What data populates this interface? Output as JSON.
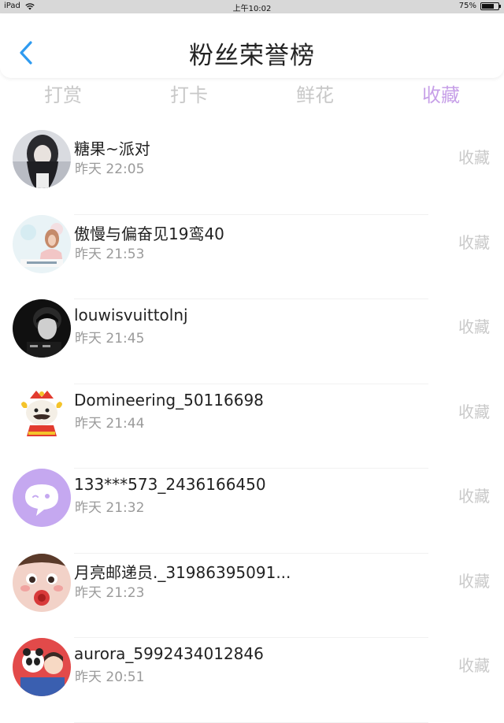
{
  "status_bar": {
    "device": "iPad",
    "time": "上午10:02",
    "battery": "75%",
    "battery_level": 0.75
  },
  "header": {
    "title": "粉丝荣誉榜",
    "back_icon": "chevron-left-icon",
    "accent_color": "#2f9bf0"
  },
  "tabs": [
    {
      "label": "打赏",
      "active": false
    },
    {
      "label": "打卡",
      "active": false
    },
    {
      "label": "鲜花",
      "active": false
    },
    {
      "label": "收藏",
      "active": true
    }
  ],
  "colors": {
    "active_tab": "#c7a0e8",
    "inactive_tab": "#c8c8c8",
    "muted_text": "#9a9a9a"
  },
  "fans": [
    {
      "name": "糖果~派对",
      "time": "昨天 22:05",
      "action": "收藏",
      "avatar": "avatar-girl-dark-hair"
    },
    {
      "name": "傲慢与偏奋见19鸾40",
      "time": "昨天 21:53",
      "action": "收藏",
      "avatar": "avatar-girl-light"
    },
    {
      "name": "louwisvuittolnj",
      "time": "昨天 21:45",
      "action": "收藏",
      "avatar": "avatar-dark-portrait"
    },
    {
      "name": "Domineering_50116698",
      "time": "昨天 21:44",
      "action": "收藏",
      "avatar": "avatar-cartoon-cow"
    },
    {
      "name": "133***573_2436166450",
      "time": "昨天 21:32",
      "action": "收藏",
      "avatar": "avatar-purple-chat"
    },
    {
      "name": "月亮邮递员._31986395091...",
      "time": "昨天 21:23",
      "action": "收藏",
      "avatar": "avatar-doll-face"
    },
    {
      "name": "aurora_5992434012846",
      "time": "昨天 20:51",
      "action": "收藏",
      "avatar": "avatar-panda-red"
    }
  ]
}
